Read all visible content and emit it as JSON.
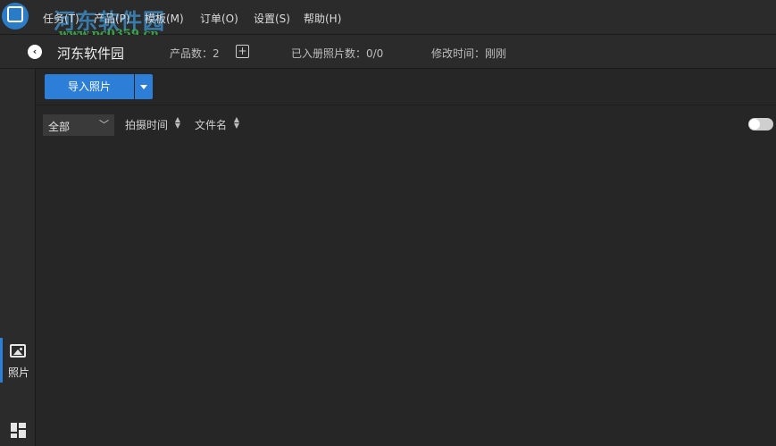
{
  "watermark": {
    "text": "河东软件园",
    "url": "www.pc0359.cn"
  },
  "menu": {
    "items": [
      {
        "label": "任务(T)"
      },
      {
        "label": "产品(P)"
      },
      {
        "label": "模板(M)"
      },
      {
        "label": "订单(O)"
      },
      {
        "label": "设置(S)"
      },
      {
        "label": "帮助(H)"
      }
    ]
  },
  "header": {
    "project_name": "河东软件园",
    "product_count": "产品数：2",
    "registered_photos": "已入册照片数：0/0",
    "modified_time": "修改时间：刚刚",
    "add_symbol": "+",
    "back_symbol": "‹"
  },
  "toolbar": {
    "import_label": "导入照片"
  },
  "filter": {
    "selected": "全部",
    "sort_by_time": "拍摄时间",
    "sort_by_filename": "文件名",
    "view_toggle_on": false
  },
  "sidebar": {
    "photos_label": "照片",
    "accent_color": "#2c7ed6"
  },
  "icons": {
    "logo": "app-logo-icon",
    "back": "chevron-left-icon",
    "add": "plus-square-icon",
    "photos": "image-icon",
    "layout": "grid-layout-icon",
    "dropdown": "caret-down-icon",
    "sort": "sort-updown-icon"
  }
}
